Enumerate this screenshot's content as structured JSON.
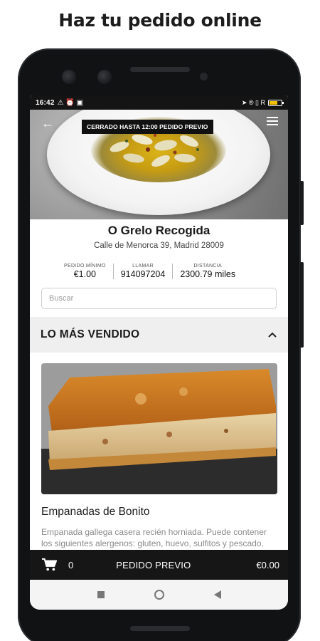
{
  "headline": "Haz tu pedido online",
  "status_bar": {
    "time": "16:42",
    "left_icons": "⚠ ⏰ ▣",
    "right_icons": "➤ ® ▯ R"
  },
  "hero": {
    "badge": "CERRADO HASTA 12:00 PEDIDO PREVIO",
    "back_icon": "arrow-left-icon",
    "menu_icon": "hamburger-menu-icon"
  },
  "restaurant": {
    "name": "O Grelo Recogida",
    "address": "Calle de Menorca 39, Madrid 28009"
  },
  "info": [
    {
      "label": "PEDIDO MÍNIMO",
      "value": "€1.00"
    },
    {
      "label": "LLAMAR",
      "value": "914097204"
    },
    {
      "label": "DISTANCIA",
      "value": "2300.79  miles"
    }
  ],
  "search": {
    "placeholder": "Buscar"
  },
  "section": {
    "title": "LO MÁS VENDIDO",
    "icon": "chevron-up-icon"
  },
  "product": {
    "name": "Empanadas de Bonito",
    "description": "Empanada gallega casera recién horniada. Puede contener los siguientes alergenos: gluten, huevo, sulfitos y pescado."
  },
  "cart": {
    "icon": "cart-icon",
    "count": "0",
    "cta": "PEDIDO PREVIO",
    "total": "€0.00"
  },
  "colors": {
    "dark": "#161616",
    "section_bg": "#efefef",
    "text_muted": "#8a8a8a"
  }
}
